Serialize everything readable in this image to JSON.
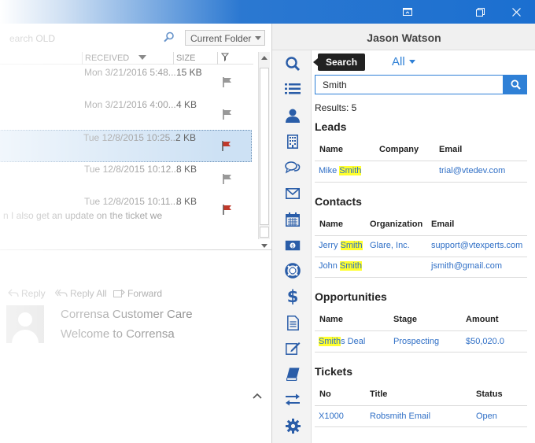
{
  "window": {
    "icons": [
      "restore-down-icon",
      "maximize-icon",
      "close-icon"
    ]
  },
  "outlook": {
    "search_placeholder": "earch OLD",
    "folder_scope": "Current Folder",
    "columns": {
      "received": "RECEIVED",
      "size": "SIZE"
    },
    "messages": [
      {
        "date": "Mon 3/21/2016 5:48...",
        "size": "15 KB",
        "flag": "gray",
        "preview": ""
      },
      {
        "date": "Mon 3/21/2016 4:00...",
        "size": "4 KB",
        "flag": "gray",
        "preview": ""
      },
      {
        "date": "Tue 12/8/2015 10:25...",
        "size": "2 KB",
        "flag": "red",
        "preview": ""
      },
      {
        "date": "Tue 12/8/2015 10:12...",
        "size": "8 KB",
        "flag": "gray",
        "preview": ""
      },
      {
        "date": "Tue 12/8/2015 10:11...",
        "size": "8 KB",
        "flag": "red",
        "preview": "n I also get an update on the ticket we"
      }
    ],
    "actions": {
      "reply": "Reply",
      "reply_all": "Reply All",
      "forward": "Forward"
    },
    "reading_pane": {
      "sender": "Corrensa Customer Care",
      "subject": "Welcome to Corrensa"
    }
  },
  "crm": {
    "user_name": "Jason Watson",
    "tooltip": "Search",
    "module_filter": "All",
    "search_value": "Smith",
    "results_label": "Results: 5",
    "colors": {
      "accent": "#2f80d6",
      "highlight": "#ffff2e"
    },
    "rail_icons": [
      "search-icon",
      "list-icon",
      "person-icon",
      "building-icon",
      "chat-icon",
      "envelope-icon",
      "calendar-icon",
      "money-icon",
      "lifebuoy-icon",
      "dollar-icon",
      "document-icon",
      "edit-icon",
      "book-icon",
      "sync-icon",
      "gear-icon"
    ],
    "leads": {
      "title": "Leads",
      "headers": [
        "Name",
        "Company",
        "Email"
      ],
      "rows": [
        {
          "name_pre": "Mike ",
          "name_match": "Smith",
          "name_post": "",
          "company": "",
          "email": "trial@vtedev.com"
        }
      ]
    },
    "contacts": {
      "title": "Contacts",
      "headers": [
        "Name",
        "Organization",
        "Email"
      ],
      "rows": [
        {
          "name_pre": "Jerry ",
          "name_match": "Smith",
          "name_post": "",
          "org": "Glare, Inc.",
          "email": "support@vtexperts.com"
        },
        {
          "name_pre": "John ",
          "name_match": "Smith",
          "name_post": "",
          "org": "",
          "email": "jsmith@gmail.com"
        }
      ]
    },
    "opportunities": {
      "title": "Opportunities",
      "headers": [
        "Name",
        "Stage",
        "Amount"
      ],
      "rows": [
        {
          "name_pre": "",
          "name_match": "Smith",
          "name_post": "s Deal",
          "stage": "Prospecting",
          "amount": "$50,020.0"
        }
      ]
    },
    "tickets": {
      "title": "Tickets",
      "headers": [
        "No",
        "Title",
        "Status"
      ],
      "rows": [
        {
          "no": "X1000",
          "title": "Robsmith Email",
          "status": "Open"
        }
      ]
    }
  }
}
